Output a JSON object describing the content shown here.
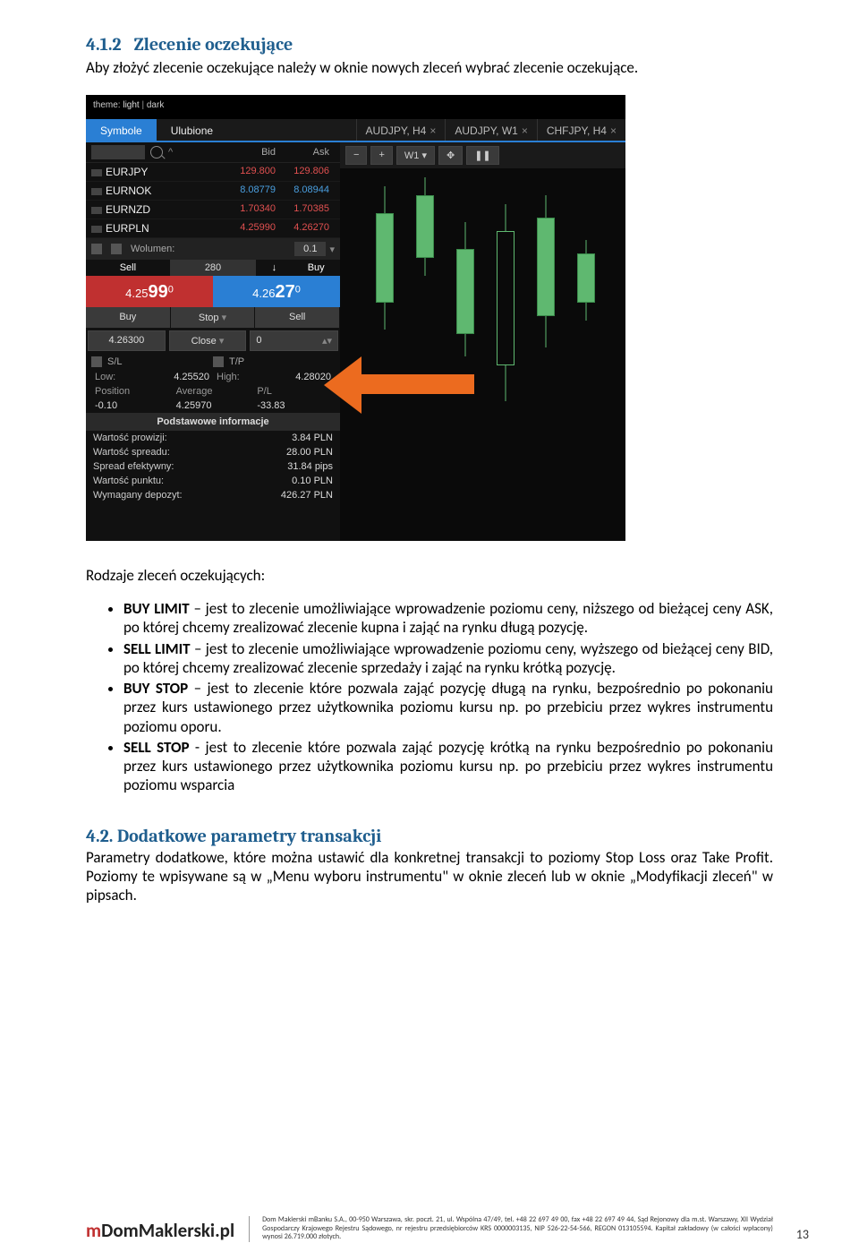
{
  "section": {
    "num": "4.1.2",
    "title": "Zlecenie oczekujące"
  },
  "intro": "Aby złożyć zlecenie oczekujące należy w oknie nowych zleceń wybrać zlecenie oczekujące.",
  "ui": {
    "theme_label": "theme:",
    "theme_light": "light",
    "theme_dark": "dark",
    "tabs_left": [
      "Symbole",
      "Ulubione"
    ],
    "tabs_right": [
      {
        "label": "AUDJPY, H4"
      },
      {
        "label": "AUDJPY, W1"
      },
      {
        "label": "CHFJPY, H4"
      }
    ],
    "col_headers": {
      "bid": "Bid",
      "ask": "Ask"
    },
    "symbols": [
      {
        "sym": "EURJPY",
        "bid": "129.800",
        "ask": "129.806",
        "cls": "red"
      },
      {
        "sym": "EURNOK",
        "bid": "8.08779",
        "ask": "8.08944",
        "cls": "blue"
      },
      {
        "sym": "EURNZD",
        "bid": "1.70340",
        "ask": "1.70385",
        "cls": "red"
      },
      {
        "sym": "EURPLN",
        "bid": "4.25990",
        "ask": "4.26270",
        "cls": "red"
      }
    ],
    "volume_label": "Wolumen:",
    "volume_val": "0.1",
    "sell_label": "Sell",
    "buy_label": "Buy",
    "spread_mid": "280",
    "sell_price_pre": "4.25",
    "sell_price_big": "99",
    "sell_price_sup": "0",
    "buy_price_pre": "4.26",
    "buy_price_big": "27",
    "buy_price_sup": "0",
    "action_buy": "Buy",
    "action_stop": "Stop",
    "action_sell": "Sell",
    "input_price": "4.26300",
    "input_close": "Close",
    "input_zero": "0",
    "sl": "S/L",
    "tp": "T/P",
    "low_lbl": "Low:",
    "low_val": "4.25520",
    "high_lbl": "High:",
    "high_val": "4.28020",
    "pos_lbl": "Position",
    "avg_lbl": "Average",
    "pl_lbl": "P/L",
    "pos_val": "-0.10",
    "avg_val": "4.25970",
    "pl_val": "-33.83",
    "basic_hdr": "Podstawowe informacje",
    "kv": [
      {
        "k": "Wartość prowizji:",
        "v": "3.84 PLN"
      },
      {
        "k": "Wartość spreadu:",
        "v": "28.00 PLN"
      },
      {
        "k": "Spread efektywny:",
        "v": "31.84 pips"
      },
      {
        "k": "Wartość punktu:",
        "v": "0.10 PLN"
      },
      {
        "k": "Wymagany depozyt:",
        "v": "426.27 PLN"
      }
    ],
    "chart_tb": [
      "−",
      "+",
      "W1",
      "▾",
      "✥",
      "❚❚"
    ]
  },
  "rodzaje_title": "Rodzaje zleceń oczekujących:",
  "bullets": [
    {
      "b": "BUY LIMIT",
      "t": " – jest to zlecenie umożliwiające wprowadzenie poziomu ceny, niższego od bieżącej ceny ASK, po której chcemy zrealizować zlecenie kupna i zająć na rynku długą pozycję."
    },
    {
      "b": "SELL LIMIT",
      "t": " – jest to zlecenie umożliwiające wprowadzenie poziomu ceny, wyższego od bieżącej ceny BID, po której chcemy zrealizować zlecenie sprzedaży i zająć na rynku krótką pozycję."
    },
    {
      "b": "BUY STOP",
      "t": " – jest to zlecenie które pozwala zająć pozycję długą na rynku, bezpośrednio po pokonaniu przez kurs ustawionego przez użytkownika poziomu kursu np. po przebiciu przez wykres instrumentu poziomu oporu."
    },
    {
      "b": "SELL STOP",
      "t": " - jest to zlecenie które pozwala zająć pozycję krótką na rynku bezpośrednio po pokonaniu przez kurs ustawionego przez użytkownika poziomu kursu np. po przebiciu przez wykres instrumentu poziomu wsparcia"
    }
  ],
  "sec42": {
    "num": "4.2.",
    "title": "Dodatkowe parametry transakcji",
    "body": "Parametry dodatkowe, które można ustawić dla konkretnej transakcji to poziomy Stop Loss oraz Take Profit. Poziomy te wpisywane są w „Menu wyboru instrumentu\" w oknie zleceń lub w oknie „Modyfikacji zleceń\" w pipsach."
  },
  "footer": {
    "logo_m": "m",
    "logo_rest": "DomMaklerski",
    "logo_pl": ".pl",
    "text": "Dom Maklerski mBanku S.A., 00-950 Warszawa, skr. poczt. 21, ul. Wspólna 47/49, tel. +48 22 697 49 00, fax +48 22 697 49 44, Sąd Rejonowy dla m.st. Warszawy, XII Wydział Gospodarczy Krajowego Rejestru Sądowego, nr rejestru przedsiębiorców KRS 0000003135, NIP 526-22-54-566, REGON 013105594. Kapitał zakładowy (w całości wpłacony) wynosi 26.719.000 złotych."
  },
  "page_number": "13"
}
